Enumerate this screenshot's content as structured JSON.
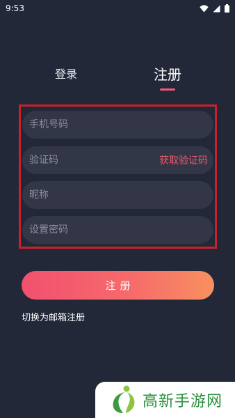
{
  "status_bar": {
    "time": "9:53",
    "icons": [
      "wifi-icon",
      "cell-signal-icon",
      "battery-icon"
    ]
  },
  "tabs": {
    "login": "登录",
    "register": "注册",
    "active": "register"
  },
  "form": {
    "phone_placeholder": "手机号码",
    "code_placeholder": "验证码",
    "get_code": "获取验证码",
    "nickname_placeholder": "昵称",
    "password_placeholder": "设置密码"
  },
  "register_button": "注册",
  "switch_link": "切换为邮箱注册",
  "watermark": {
    "text": "高新手游网",
    "icon": "watermark-logo-icon"
  },
  "colors": {
    "background": "#232838",
    "input": "#323647",
    "accent": "#f25a78",
    "get_code": "#e95a6a",
    "highlight_frame": "#c92129",
    "button_gradient_start": "#f2506f",
    "button_gradient_end": "#f8905f",
    "watermark_text": "#2a8f3c"
  }
}
